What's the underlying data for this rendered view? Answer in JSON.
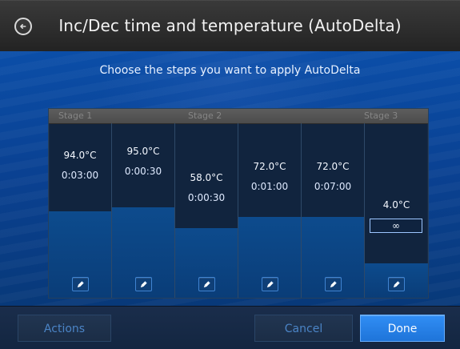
{
  "header": {
    "title": "Inc/Dec time and temperature (AutoDelta)"
  },
  "main": {
    "instruction": "Choose the steps you want to apply AutoDelta"
  },
  "panel": {
    "stages": [
      {
        "label": "Stage 1"
      },
      {
        "label": "Stage 2"
      },
      {
        "label": "Stage 3"
      }
    ],
    "steps": [
      {
        "temp": "94.0°C",
        "time": "0:03:00"
      },
      {
        "temp": "95.0°C",
        "time": "0:00:30"
      },
      {
        "temp": "58.0°C",
        "time": "0:00:30"
      },
      {
        "temp": "72.0°C",
        "time": "0:01:00"
      },
      {
        "temp": "72.0°C",
        "time": "0:07:00"
      },
      {
        "temp": "4.0°C",
        "time": "∞"
      }
    ]
  },
  "footer": {
    "actions_label": "Actions",
    "cancel_label": "Cancel",
    "done_label": "Done"
  },
  "colors": {
    "header_bg": "#2b2b2b",
    "main_blue": "#0b4ea8",
    "panel_bg": "#11243e",
    "primary_button": "#1e74d9",
    "muted_button_text": "#4b84c6"
  },
  "icons": {
    "back": "back-arrow-icon",
    "edit": "pencil-icon"
  }
}
